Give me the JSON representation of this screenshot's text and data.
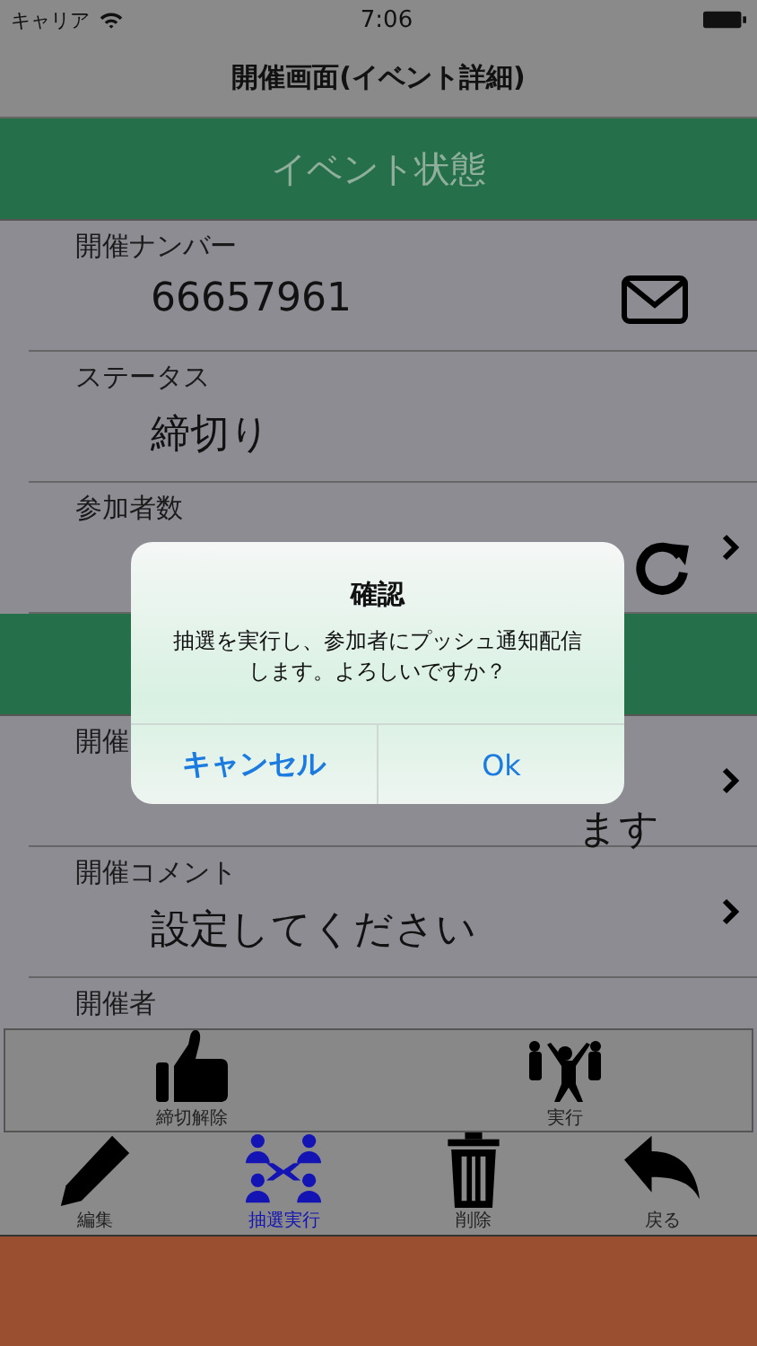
{
  "status_bar": {
    "carrier": "キャリア",
    "time": "7:06"
  },
  "navigation_bar": {
    "title": "開催画面(イベント詳細)"
  },
  "list": [
    {
      "kind": "header",
      "text": "イベント状態"
    },
    {
      "kind": "row",
      "label": "開催ナンバー",
      "value": "66657961"
    },
    {
      "kind": "row",
      "label": "ステータス",
      "value": "締切り"
    },
    {
      "kind": "row",
      "label": "参加者数",
      "chevron": true
    },
    {
      "kind": "header"
    },
    {
      "kind": "covered",
      "label": "開催",
      "value": "ます",
      "chevron": true
    },
    {
      "kind": "row",
      "label": "開催コメント",
      "value": "設定してください",
      "chevron": true
    },
    {
      "kind": "partial",
      "label": "開催者"
    }
  ],
  "toolbar": [
    {
      "label": "締切解除"
    },
    {
      "label": "実行"
    }
  ],
  "tab_bar": [
    {
      "label": "編集",
      "selected": false
    },
    {
      "label": "抽選実行",
      "selected": true
    },
    {
      "label": "削除",
      "selected": false
    },
    {
      "label": "戻る",
      "selected": false
    }
  ],
  "alert": {
    "title": "確認",
    "message": "抽選を実行し、参加者にプッシュ通知配信します。よろしいですか？",
    "buttons": [
      "キャンセル",
      "Ok"
    ]
  }
}
